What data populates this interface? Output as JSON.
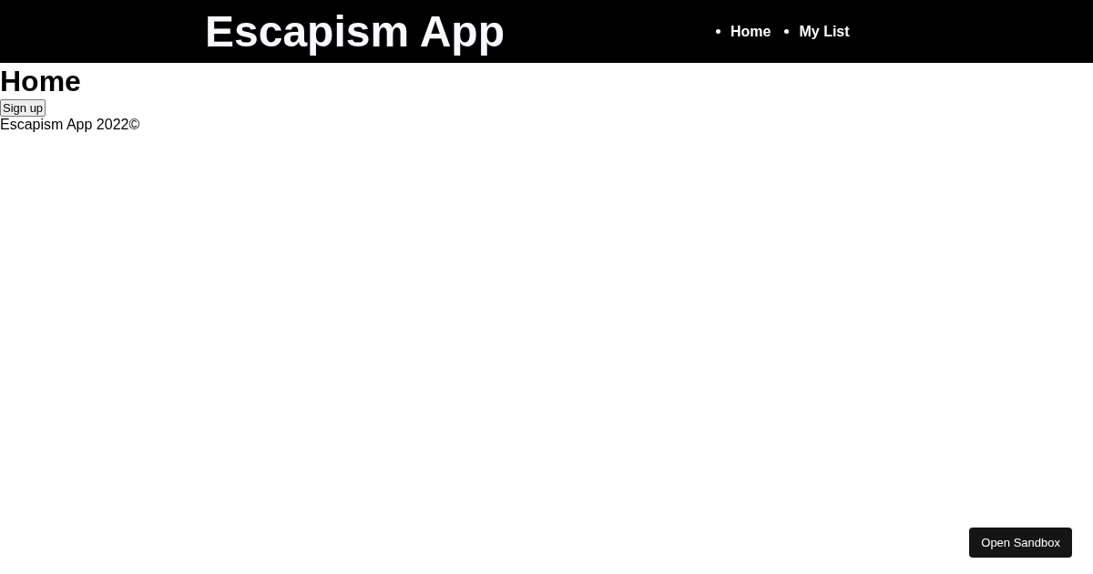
{
  "header": {
    "title": "Escapism App",
    "nav": [
      {
        "label": "Home"
      },
      {
        "label": "My List"
      }
    ]
  },
  "page": {
    "heading": "Home",
    "button": "Sign up",
    "footer": "Escapism App 2022©"
  },
  "sandbox_button": "Open Sandbox"
}
